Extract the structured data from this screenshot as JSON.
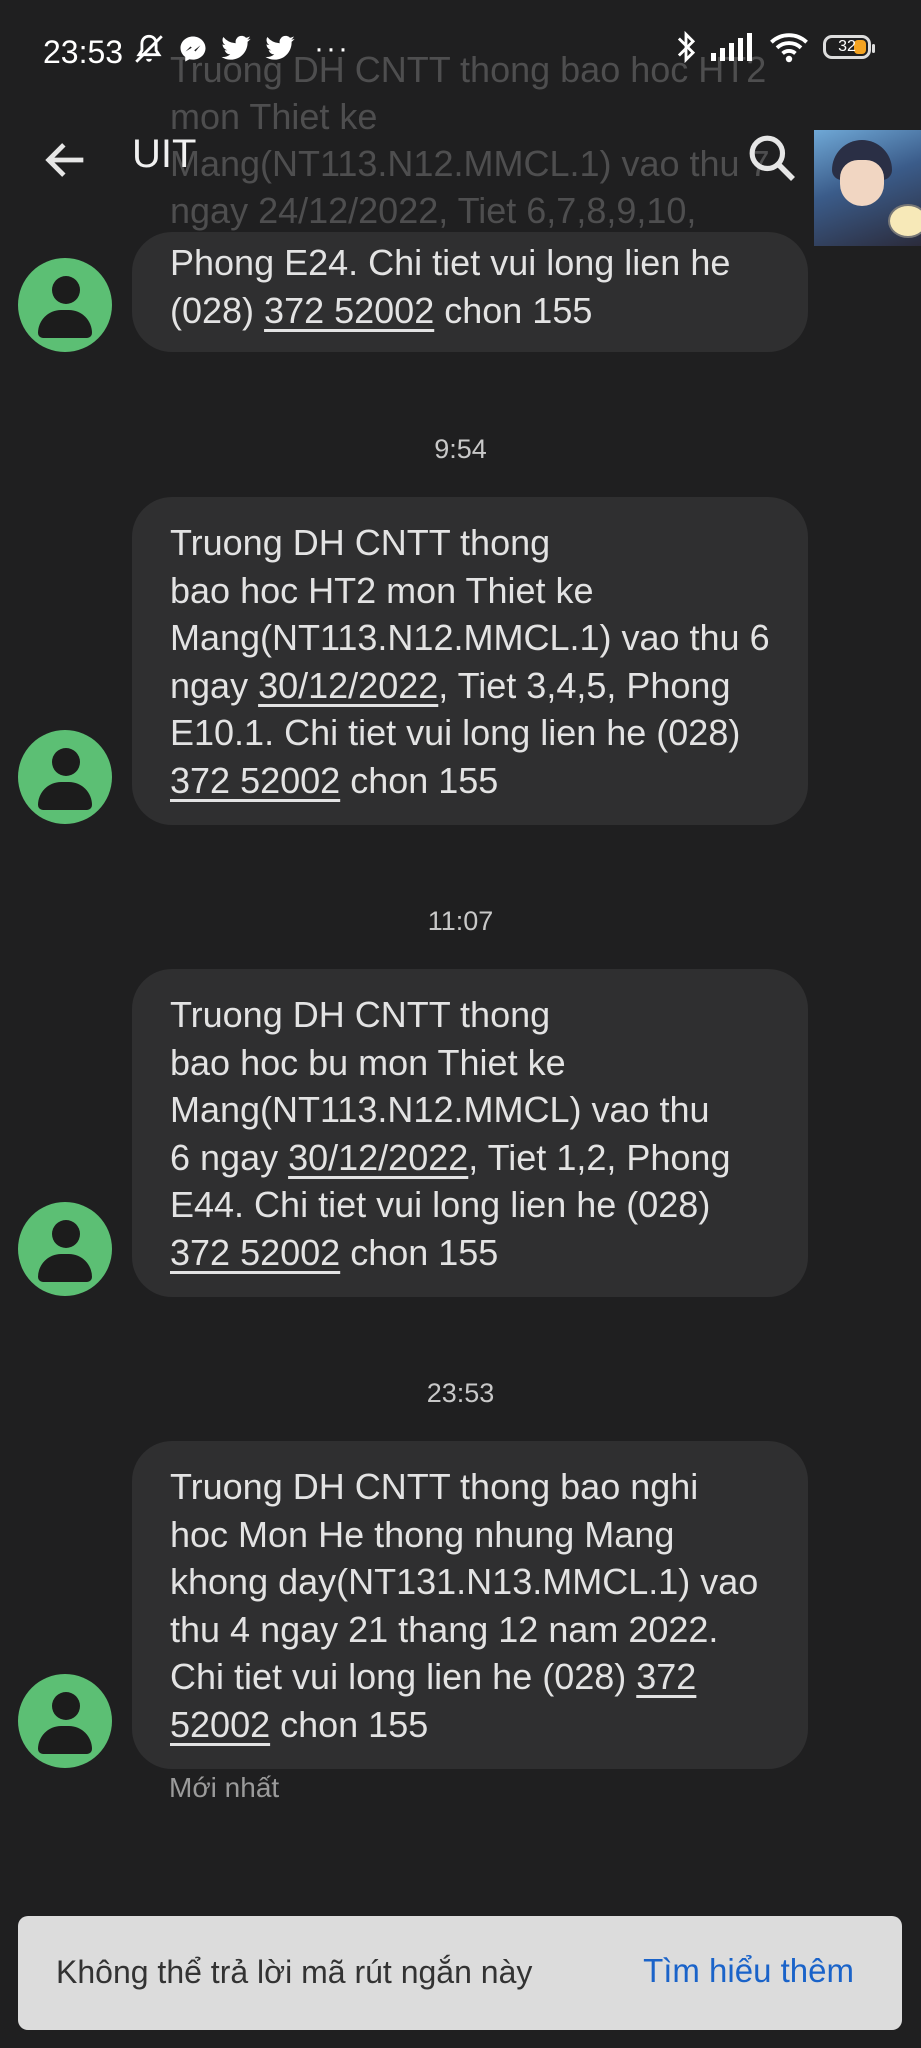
{
  "status_bar": {
    "time": "23:53",
    "battery_level": "32",
    "left_icons": [
      "mute-icon",
      "messenger-icon",
      "twitter-icon",
      "twitter-icon"
    ],
    "more": "···",
    "right_icons": [
      "bluetooth-icon",
      "signal-icon",
      "wifi-icon",
      "battery-icon"
    ]
  },
  "app_bar": {
    "title": "UIT"
  },
  "ghost_message": {
    "text": "Truong DH CNTT thong bao hoc HT2 mon Thiet ke Mang(NT113.N12.MMCL.1) vao thu 7 ngay 24/12/2022, Tiet 6,7,8,9,10,"
  },
  "messages": [
    {
      "time": "",
      "lines": [
        {
          "parts": [
            {
              "t": "Phong E24. Chi tiet vui long lien he"
            }
          ]
        },
        {
          "parts": [
            {
              "t": "(028) "
            },
            {
              "t": "372 52002",
              "u": true
            },
            {
              "t": " chon 155"
            }
          ]
        }
      ]
    },
    {
      "time": "9:54",
      "lines": [
        {
          "parts": [
            {
              "t": "Truong DH CNTT thong"
            }
          ]
        },
        {
          "parts": [
            {
              "t": "bao hoc HT2 mon Thiet ke"
            }
          ]
        },
        {
          "parts": [
            {
              "t": "Mang(NT113.N12.MMCL.1) vao thu 6"
            }
          ]
        },
        {
          "parts": [
            {
              "t": "ngay "
            },
            {
              "t": "30/12/2022",
              "u": true
            },
            {
              "t": ", Tiet 3,4,5, Phong"
            }
          ]
        },
        {
          "parts": [
            {
              "t": "E10.1. Chi tiet vui long lien he (028)"
            }
          ]
        },
        {
          "parts": [
            {
              "t": "372 52002",
              "u": true
            },
            {
              "t": " chon 155"
            }
          ]
        }
      ]
    },
    {
      "time": "11:07",
      "lines": [
        {
          "parts": [
            {
              "t": "Truong DH CNTT thong"
            }
          ]
        },
        {
          "parts": [
            {
              "t": "bao hoc bu mon Thiet ke"
            }
          ]
        },
        {
          "parts": [
            {
              "t": "Mang(NT113.N12.MMCL) vao thu"
            }
          ]
        },
        {
          "parts": [
            {
              "t": "6 ngay "
            },
            {
              "t": "30/12/2022",
              "u": true
            },
            {
              "t": ", Tiet 1,2, Phong"
            }
          ]
        },
        {
          "parts": [
            {
              "t": "E44. Chi tiet vui long lien he (028)"
            }
          ]
        },
        {
          "parts": [
            {
              "t": "372 52002",
              "u": true
            },
            {
              "t": " chon 155"
            }
          ]
        }
      ]
    },
    {
      "time": "23:53",
      "lines": [
        {
          "parts": [
            {
              "t": "Truong DH CNTT thong bao nghi"
            }
          ]
        },
        {
          "parts": [
            {
              "t": "hoc Mon He thong nhung Mang"
            }
          ]
        },
        {
          "parts": [
            {
              "t": "khong day(NT131.N13.MMCL.1) vao"
            }
          ]
        },
        {
          "parts": [
            {
              "t": "thu 4 ngay 21 thang 12 nam 2022."
            }
          ]
        },
        {
          "parts": [
            {
              "t": "Chi tiet vui long lien he (028) "
            },
            {
              "t": "372",
              "u": true
            }
          ]
        },
        {
          "parts": [
            {
              "t": "52002",
              "u": true
            },
            {
              "t": " chon 155"
            }
          ]
        }
      ]
    }
  ],
  "latest_label": "Mới nhất",
  "banner": {
    "text": "Không thể trả lời mã rút ngắn này",
    "link": "Tìm hiểu thêm"
  },
  "colors": {
    "background": "#1f1f20",
    "bubble": "#2f2f30",
    "avatar": "#5cbf74",
    "link": "#1a63c9",
    "battery": "#f4a321"
  }
}
